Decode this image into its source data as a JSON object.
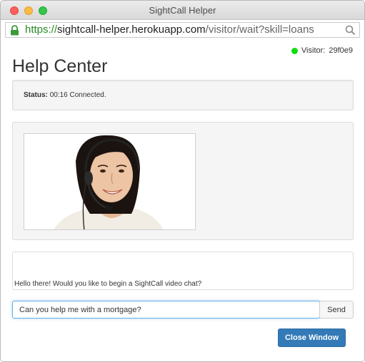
{
  "window": {
    "title": "SightCall Helper"
  },
  "urlbar": {
    "scheme": "https://",
    "host": "sightcall-helper.herokuapp.com",
    "path": "/visitor/wait?skill=loans"
  },
  "visitor": {
    "label": "Visitor:",
    "id": "29f0e9",
    "status_color": "#11dd11"
  },
  "page": {
    "title": "Help Center"
  },
  "status": {
    "label": "Status:",
    "value": "00:16 Connected."
  },
  "video": {
    "description": "agent-with-headset"
  },
  "chat": {
    "messages": [
      "Hello there! Would you like to begin a SightCall video chat?"
    ],
    "input_value": "Can you help me with a mortgage?",
    "send_label": "Send"
  },
  "actions": {
    "close_label": "Close Window",
    "close_color": "#337ab7"
  },
  "icons": {
    "lock": "lock-icon",
    "search": "search-icon"
  }
}
